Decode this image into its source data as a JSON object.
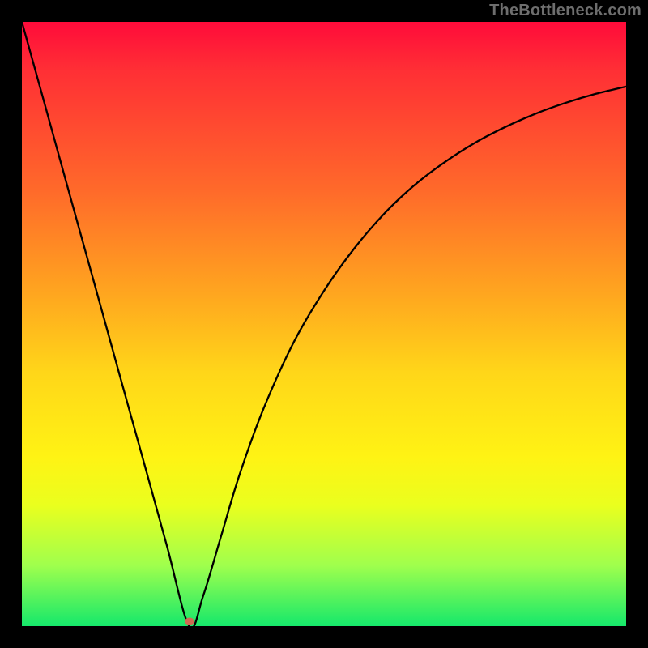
{
  "watermark": "TheBottleneck.com",
  "colors": {
    "frame_bg": "#000000",
    "gradient_top": "#ff0b3a",
    "gradient_bottom": "#15e86b",
    "curve": "#000000",
    "marker": "#cf6a53"
  },
  "chart_data": {
    "type": "line",
    "title": "",
    "xlabel": "",
    "ylabel": "",
    "xlim": [
      0,
      100
    ],
    "ylim": [
      0,
      100
    ],
    "grid": false,
    "legend": false,
    "series": [
      {
        "name": "curve",
        "x": [
          0,
          4,
          8,
          12,
          16,
          20,
          24,
          27.7,
          30,
          33,
          36,
          40,
          45,
          50,
          55,
          60,
          65,
          70,
          75,
          80,
          85,
          90,
          95,
          100
        ],
        "values": [
          100,
          85.6,
          71.1,
          56.7,
          42.2,
          27.8,
          13.3,
          0,
          5.0,
          15.0,
          25.0,
          36.0,
          47.0,
          55.5,
          62.5,
          68.3,
          73.0,
          76.8,
          80.0,
          82.6,
          84.8,
          86.6,
          88.1,
          89.3
        ]
      }
    ],
    "marker": {
      "x": 27.8,
      "y": 0.8
    },
    "annotations": []
  }
}
